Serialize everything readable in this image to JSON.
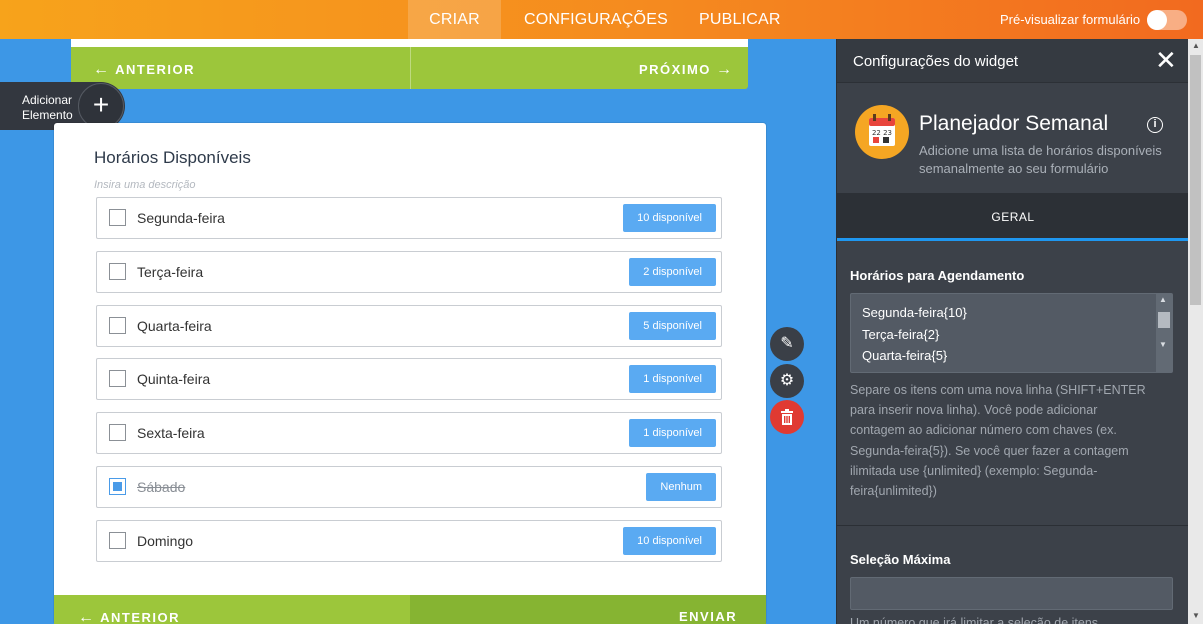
{
  "topbar": {
    "tabs": [
      {
        "label": "CRIAR"
      },
      {
        "label": "CONFIGURAÇÕES"
      },
      {
        "label": "PUBLICAR"
      }
    ],
    "preview_label": "Pré-visualizar formulário"
  },
  "canvas": {
    "prev_page": {
      "back_label": "ANTERIOR",
      "next_label": "PRÓXIMO"
    },
    "add_element": {
      "line1": "Adicionar",
      "line2": "Elemento"
    },
    "question": {
      "title": "Horários Disponíveis",
      "description_placeholder": "Insira uma descrição",
      "options": [
        {
          "label": "Segunda-feira",
          "badge": "10 disponível",
          "checked": false
        },
        {
          "label": "Terça-feira",
          "badge": "2 disponível",
          "checked": false
        },
        {
          "label": "Quarta-feira",
          "badge": "5 disponível",
          "checked": false
        },
        {
          "label": "Quinta-feira",
          "badge": "1 disponível",
          "checked": false
        },
        {
          "label": "Sexta-feira",
          "badge": "1 disponível",
          "checked": false
        },
        {
          "label": "Sábado",
          "badge": "Nenhum",
          "checked": true
        },
        {
          "label": "Domingo",
          "badge": "10 disponível",
          "checked": false
        }
      ]
    },
    "footer": {
      "back_label": "ANTERIOR",
      "submit_label": "ENVIAR"
    }
  },
  "panel": {
    "title": "Configurações do widget",
    "widget": {
      "name": "Planejador Semanal",
      "description": "Adicione uma lista de horários disponíveis semanalmente ao seu formulário",
      "icon_days": "22 23"
    },
    "tab": "GERAL",
    "schedule": {
      "label": "Horários para Agendamento",
      "lines": [
        "Segunda-feira{10}",
        "Terça-feira{2}",
        "Quarta-feira{5}"
      ],
      "help": "Separe os itens com uma nova linha (SHIFT+ENTER para inserir nova linha). Você pode adicionar contagem ao adicionar número com chaves (ex. Segunda-feira{5}). Se você quer fazer a contagem ilimitada use {unlimited} (exemplo: Segunda-feira{unlimited})"
    },
    "max_selection": {
      "label": "Seleção Máxima",
      "value": "",
      "help": "Um número que irá limitar a seleção de itens"
    }
  },
  "colors": {
    "topbar_start": "#f7a31b",
    "topbar_end": "#f26a1f",
    "canvas_bg": "#3d97e6",
    "green": "#9cc63b",
    "badge_blue": "#5aaaf2",
    "panel_bg": "#3c4149",
    "tab_accent": "#1f97f0",
    "delete_red": "#e03a32"
  }
}
